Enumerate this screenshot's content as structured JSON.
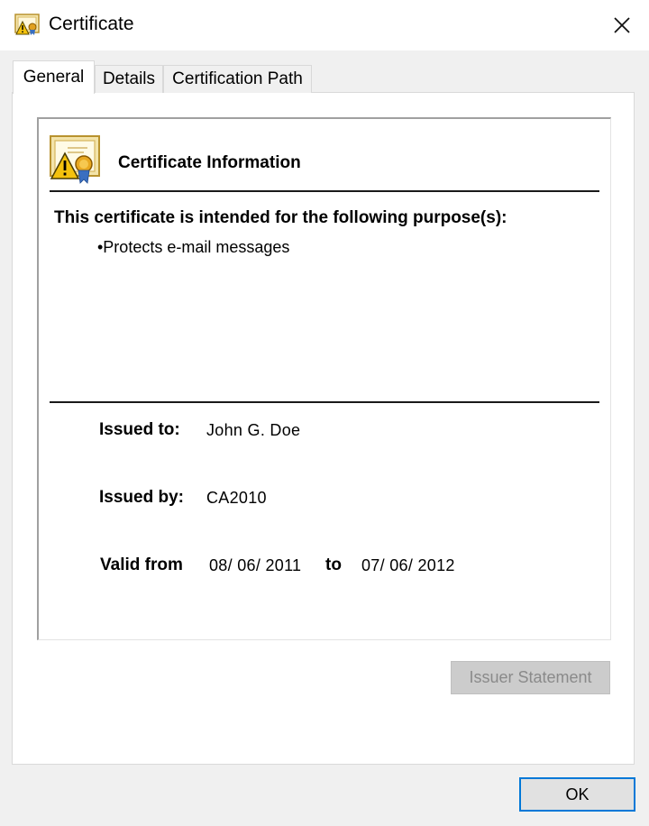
{
  "window": {
    "title": "Certificate",
    "title_icon": "certificate-icon",
    "close_icon": "close-icon"
  },
  "tabs": [
    {
      "label": "General",
      "active": true
    },
    {
      "label": "Details",
      "active": false
    },
    {
      "label": "Certification Path",
      "active": false
    }
  ],
  "info": {
    "icon": "certificate-warning-icon",
    "heading": "Certificate Information",
    "purpose_heading": "This certificate is intended for the following purpose(s):",
    "purposes": [
      "•Protects e-mail messages"
    ],
    "issued_to_label": "Issued to:",
    "issued_to_value": "John G. Doe",
    "issued_by_label": "Issued by:",
    "issued_by_value": "CA2010",
    "valid_from_label": "Valid from",
    "valid_from_value": "08/ 06/ 2011",
    "valid_to_label": "to",
    "valid_to_value": "07/ 06/ 2012"
  },
  "buttons": {
    "issuer_statement": "Issuer Statement",
    "ok": "OK"
  },
  "colors": {
    "window_bg": "#f0f0f0",
    "panel_bg": "#ffffff",
    "ok_border": "#0078d7",
    "disabled_text": "#8a8a8a"
  }
}
